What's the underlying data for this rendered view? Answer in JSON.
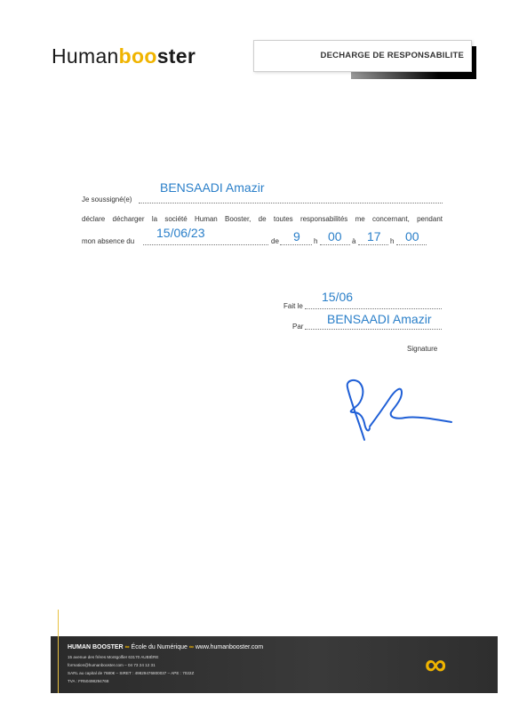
{
  "header": {
    "logo_prefix": "Human",
    "logo_oo": "boo",
    "logo_suffix": "ster",
    "title": "DECHARGE DE RESPONSABILITE"
  },
  "form": {
    "label_soussigne": "Je soussigné(e)",
    "value_soussigne": "BENSAADI Amazir",
    "paragraph": "déclare décharger la société Human Booster, de toutes responsabilités me concernant, pendant",
    "label_absence": "mon absence du",
    "value_date": "15/06/23",
    "label_de": "de",
    "value_h1": "9",
    "label_h1": "h",
    "value_m1": "00",
    "label_a": "à",
    "value_h2": "17",
    "label_h2": "h",
    "value_m2": "00",
    "label_fait": "Fait le",
    "value_fait": "15/06",
    "label_par": "Par",
    "value_par": "BENSAADI Amazir",
    "label_signature": "Signature"
  },
  "footer": {
    "brand": "HUMAN BOOSTER",
    "infinity": "∞",
    "school": "École du Numérique",
    "website": "www.humanbooster.com",
    "address": "15 avenue des frères Montgolfier 63170 AUBIÈRE",
    "contact": "formation@humanbooster.com – 04 73 24 12 31",
    "legal": "SARL au capital de 7680€ – SIRET : 49829476800037 – APE : 7022Z",
    "tva": "TVA : FR50498294768"
  },
  "colors": {
    "accent": "#f0b400",
    "handwriting": "#2a7fc9",
    "signature": "#1f5fd6"
  }
}
